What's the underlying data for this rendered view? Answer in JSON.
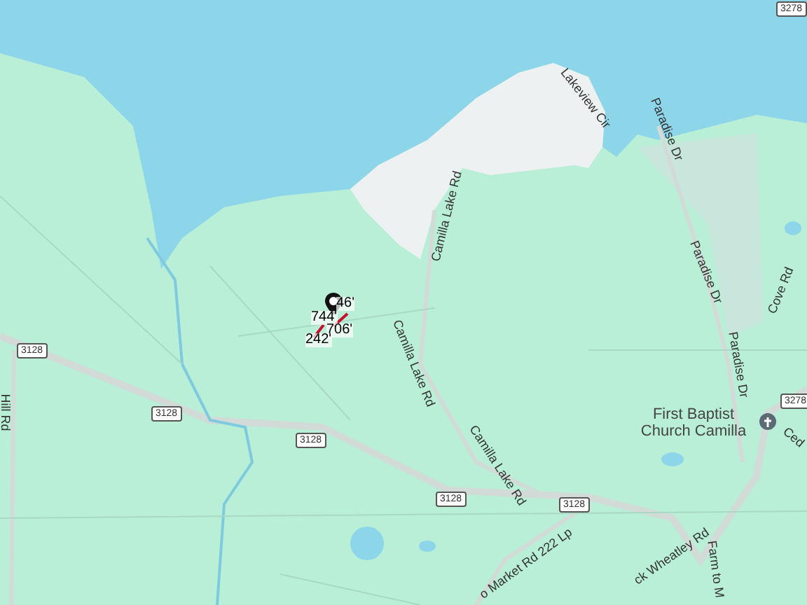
{
  "map": {
    "road_labels": [
      {
        "text": "Lakeview Cir"
      },
      {
        "text": "Camilla Lake Rd"
      },
      {
        "text": "Camilla Lake Rd"
      },
      {
        "text": "Camilla Lake Rd"
      },
      {
        "text": "Paradise Dr"
      },
      {
        "text": "Paradise Dr"
      },
      {
        "text": "Paradise Dr"
      },
      {
        "text": "Cove Rd"
      },
      {
        "text": "Ced"
      },
      {
        "text": "Farm to M"
      },
      {
        "text": "ck Wheatley Rd"
      },
      {
        "text": "o Market Rd 222 Lp"
      },
      {
        "text": "Hill Rd"
      }
    ],
    "route_shields": [
      "3128",
      "3128",
      "3128",
      "3128",
      "3128",
      "3278",
      "3278"
    ],
    "place": {
      "name": "First Baptist Church Camilla"
    },
    "measurements": [
      "744'",
      "46'",
      "706'",
      "242'"
    ]
  }
}
